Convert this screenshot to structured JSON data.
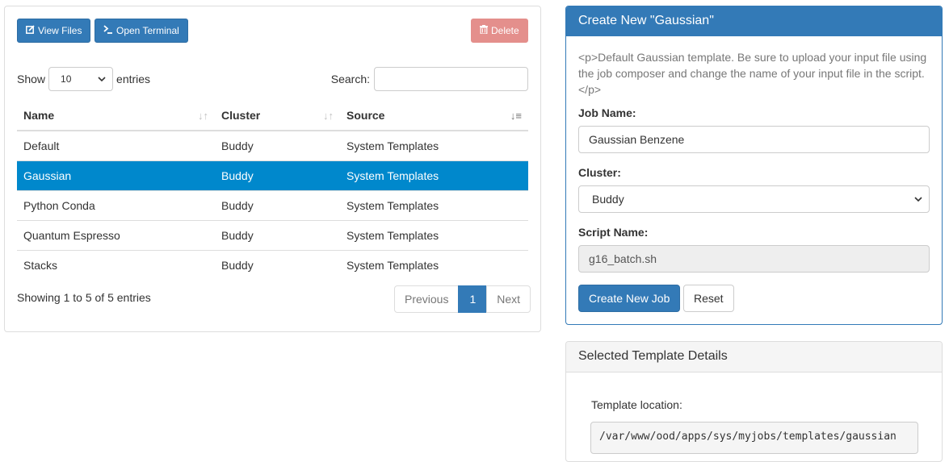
{
  "toolbar": {
    "view_files_label": "View Files",
    "open_terminal_label": "Open Terminal",
    "delete_label": "Delete"
  },
  "table_controls": {
    "show_label": "Show",
    "page_size": "10",
    "entries_label": "entries",
    "search_label": "Search:",
    "search_value": ""
  },
  "table": {
    "columns": [
      "Name",
      "Cluster",
      "Source"
    ],
    "rows": [
      {
        "name": "Default",
        "cluster": "Buddy",
        "source": "System Templates",
        "selected": false
      },
      {
        "name": "Gaussian",
        "cluster": "Buddy",
        "source": "System Templates",
        "selected": true
      },
      {
        "name": "Python Conda",
        "cluster": "Buddy",
        "source": "System Templates",
        "selected": false
      },
      {
        "name": "Quantum Espresso",
        "cluster": "Buddy",
        "source": "System Templates",
        "selected": false
      },
      {
        "name": "Stacks",
        "cluster": "Buddy",
        "source": "System Templates",
        "selected": false
      }
    ]
  },
  "footer": {
    "showing_text": "Showing 1 to 5 of 5 entries",
    "previous_label": "Previous",
    "current_page": "1",
    "next_label": "Next"
  },
  "create_panel": {
    "title": "Create New \"Gaussian\"",
    "description": "<p>Default Gaussian template. Be sure to upload your input file using the job composer and change the name of your input file in the script.</p>",
    "job_name_label": "Job Name:",
    "job_name_value": "Gaussian Benzene",
    "cluster_label": "Cluster:",
    "cluster_value": "Buddy",
    "script_name_label": "Script Name:",
    "script_name_value": "g16_batch.sh",
    "create_button": "Create New Job",
    "reset_button": "Reset"
  },
  "details_panel": {
    "title": "Selected Template Details",
    "location_label": "Template location:",
    "location_value": "/var/www/ood/apps/sys/myjobs/templates/gaussian"
  },
  "colors": {
    "primary": "#337ab7",
    "selected_row": "#0088cc",
    "danger_disabled": "#e48f8c"
  },
  "icons": {
    "view_files": "edit-icon",
    "open_terminal": "terminal-icon",
    "delete": "trash-icon"
  }
}
